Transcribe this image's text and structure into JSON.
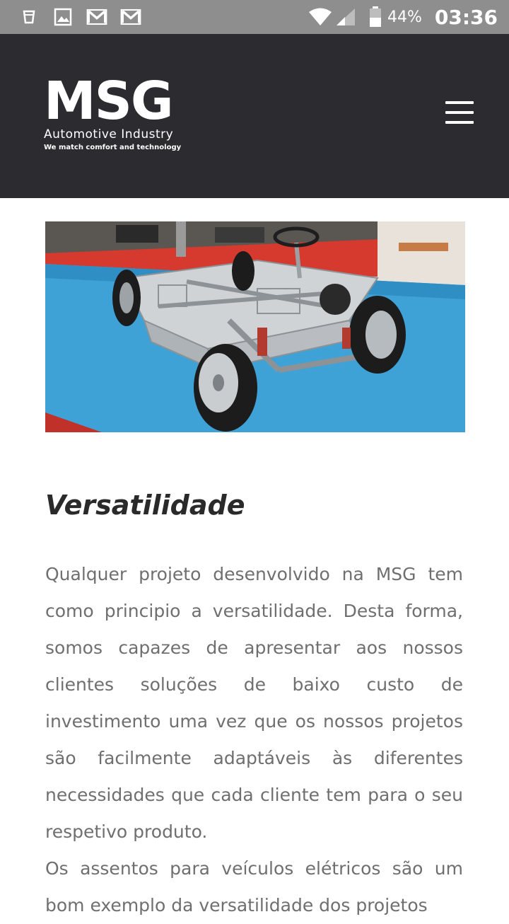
{
  "status_bar": {
    "icons": [
      "cup-icon",
      "image-icon",
      "gmail-icon",
      "gmail-icon"
    ],
    "battery_percent": "44%",
    "time": "03:36"
  },
  "header": {
    "logo_text": "MSG",
    "logo_subtitle": "Automotive Industry",
    "logo_tagline": "We match comfort and technology",
    "background_color": "#2b2b30"
  },
  "article": {
    "title": "Versatilidade",
    "paragraph1": "Qualquer projeto desenvolvido na MSG tem como principio a versatilidade. Desta forma, somos capazes de apresentar aos nossos clientes soluções de baixo custo de investimento uma vez que os nossos projetos são facilmente adaptáveis às diferentes necessidades que cada cliente tem para o seu respetivo produto.",
    "paragraph2": "Os assentos para veículos elétricos são um bom exemplo da versatilidade dos projetos"
  }
}
